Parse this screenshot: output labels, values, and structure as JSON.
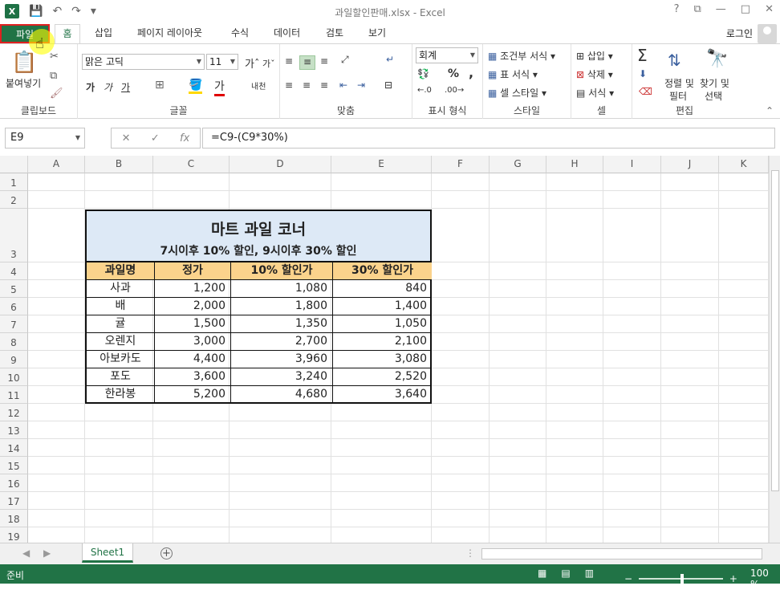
{
  "window": {
    "title": "과일할인판매.xlsx - Excel",
    "controls": [
      "?",
      "⧉",
      "—",
      "□",
      "✕"
    ]
  },
  "qat": {
    "app_icon": "X"
  },
  "tabs": [
    "파일",
    "홈",
    "삽입",
    "페이지 레이아웃",
    "수식",
    "데이터",
    "검토",
    "보기"
  ],
  "login": "로그인",
  "ribbon": {
    "clipboard": {
      "paste": "붙여넣기",
      "label": "클립보드"
    },
    "font": {
      "name": "맑은 고딕",
      "size": "11",
      "label": "글꼴",
      "bold": "가",
      "italic": "가",
      "underline": "가"
    },
    "align": {
      "label": "맞춤",
      "wrap": "내/",
      "wrap2": ""
    },
    "number": {
      "format": "회계",
      "label": "표시 형식",
      "percent": "%",
      "comma": ","
    },
    "styles": {
      "cond": "조건부 서식",
      "table": "표 서식",
      "cell": "셀 스타일",
      "label": "스타일"
    },
    "cells": {
      "insert": "삽입",
      "delete": "삭제",
      "format": "서식",
      "label": "셀"
    },
    "edit": {
      "sort": "정렬 및",
      "filter": "필터",
      "find": "찾기 및",
      "select": "선택",
      "label": "편집"
    }
  },
  "formula_bar": {
    "namebox": "E9",
    "formula": "=C9-(C9*30%)"
  },
  "columns": [
    "A",
    "B",
    "C",
    "D",
    "E",
    "F",
    "G",
    "H",
    "I",
    "J",
    "K"
  ],
  "rows": [
    "1",
    "2",
    "3",
    "4",
    "5",
    "6",
    "7",
    "8",
    "9",
    "10",
    "11",
    "12",
    "13",
    "14",
    "15",
    "16",
    "17",
    "18",
    "19"
  ],
  "sheet": {
    "title": "마트 과일 코너",
    "subtitle": "7시이후 10% 할인, 9시이후 30% 할인",
    "headers": [
      "과일명",
      "정가",
      "10% 할인가",
      "30% 할인가"
    ],
    "data": [
      [
        "사과",
        "1,200",
        "1,080",
        "840"
      ],
      [
        "배",
        "2,000",
        "1,800",
        "1,400"
      ],
      [
        "귤",
        "1,500",
        "1,350",
        "1,050"
      ],
      [
        "오렌지",
        "3,000",
        "2,700",
        "2,100"
      ],
      [
        "아보카도",
        "4,400",
        "3,960",
        "3,080"
      ],
      [
        "포도",
        "3,600",
        "3,240",
        "2,520"
      ],
      [
        "한라봉",
        "5,200",
        "4,680",
        "3,640"
      ]
    ]
  },
  "sheet_tabs": [
    "Sheet1"
  ],
  "status": {
    "ready": "준비",
    "zoom": "100 %"
  },
  "colors": {
    "accent": "#217346",
    "header_fill": "#fbd38c",
    "title_fill": "#dde9f6"
  }
}
